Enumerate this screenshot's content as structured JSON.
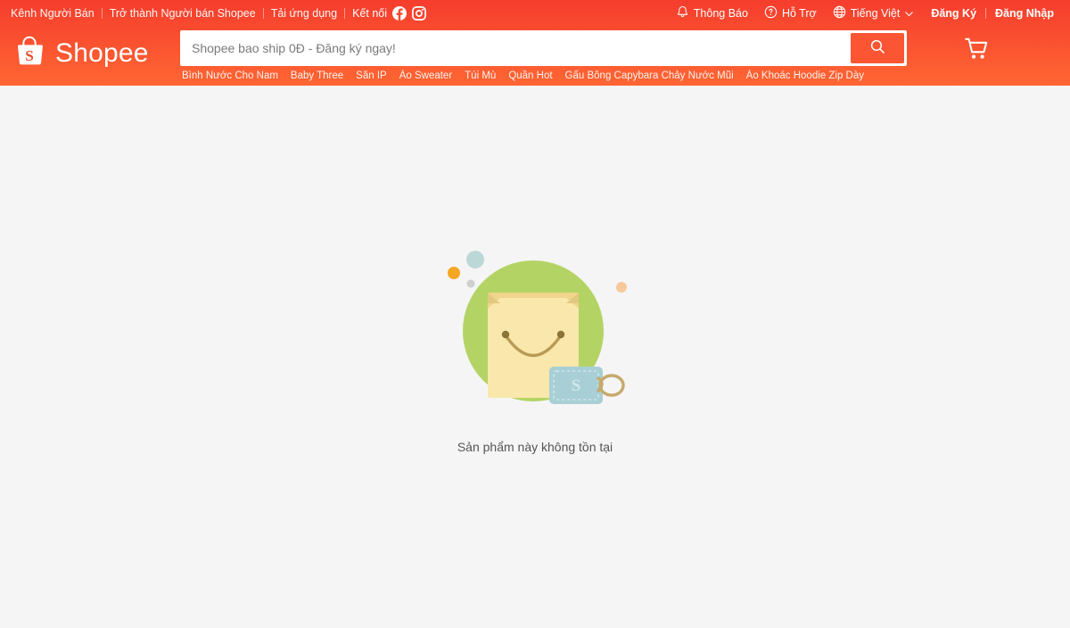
{
  "colors": {
    "brand_orange": "#ee4d2d",
    "header_gradient_from": "#f53d2d",
    "header_gradient_to": "#ff6633",
    "page_background": "#f5f5f5",
    "illustration_circle_green": "#b3d465",
    "illustration_bag_body": "#f9e6a8",
    "illustration_bag_flap": "#f2d894",
    "illustration_handle": "#b99a55",
    "illustration_tag_blue": "#a8cfd6",
    "caption_text": "#555555",
    "dot_orange": "#f5a623",
    "dot_teal": "#bcd8d6",
    "dot_gray": "#c9c9c9",
    "dot_peach": "#f6c99a"
  },
  "topbar": {
    "left_links": [
      {
        "label": "Kênh Người Bán",
        "name": "seller-channel"
      },
      {
        "label": "Trở thành Người bán Shopee",
        "name": "become-seller"
      },
      {
        "label": "Tải ứng dụng",
        "name": "download-app"
      }
    ],
    "connect_label": "Kết nối",
    "social": [
      {
        "name": "facebook-icon",
        "label": "Facebook"
      },
      {
        "name": "instagram-icon",
        "label": "Instagram"
      }
    ],
    "notifications": {
      "label": "Thông Báo",
      "icon": "bell-icon"
    },
    "support": {
      "label": "Hỗ Trợ",
      "icon": "question-circle-icon"
    },
    "language": {
      "label": "Tiếng Việt",
      "icon": "globe-icon",
      "chevron": "chevron-down-icon"
    },
    "signup": "Đăng Ký",
    "login": "Đăng Nhập"
  },
  "header": {
    "logo_text": "Shopee",
    "logo_icon": "shopee-bag-logo",
    "cart_icon": "shopping-cart-icon",
    "search": {
      "placeholder": "Shopee bao ship 0Đ - Đăng ký ngay!",
      "value": "",
      "button_icon": "search-icon"
    },
    "keywords": [
      "Bình Nước Cho Nam",
      "Baby Three",
      "Săn IP",
      "Áo Sweater",
      "Túi Mù",
      "Quần Hot",
      "Gấu Bông Capybara Chảy Nước Mũi",
      "Áo Khoác Hoodie Zip Dày"
    ]
  },
  "main": {
    "empty_state": {
      "illustration": "empty-product-bag-illustration",
      "tag_letter": "S",
      "message": "Sản phẩm này không tồn tại"
    }
  }
}
